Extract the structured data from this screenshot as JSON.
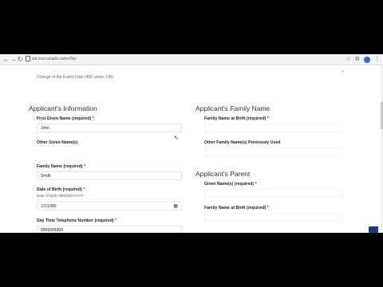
{
  "browser": {
    "url": "sin.mw.canada.ca/en/5ec",
    "back_icon": "arrow-left-icon",
    "forward_icon": "arrow-right-icon",
    "reload_icon": "reload-icon"
  },
  "select": {
    "value": "Change of the Expiry Date (400 series SIN)"
  },
  "applicant": {
    "title": "Applicant's Information",
    "first_name_label": "First Given Name (required)",
    "first_name_value": "John",
    "other_names_label": "Other Given Name(s)",
    "family_name_label": "Family Name (required)",
    "family_name_value": "Smith",
    "dob_label": "Date of Birth (required)",
    "dob_hint": "Date of Birth \"MM/DD/YYYY\"",
    "dob_value": "1/1/1990",
    "phone_label": "Day Time Telephone Number (required)",
    "phone_value": "9999999999",
    "required_mark": "*"
  },
  "family": {
    "title": "Applicant's Family Name",
    "birth_name_label": "Family Name at Birth (required)",
    "previous_label": "Other Family Name(s) Previously Used"
  },
  "parent": {
    "title": "Applicant's Parent",
    "given_label": "Given Name(s) (required)",
    "birth_name_label": "Family Name at Birth (required)"
  }
}
